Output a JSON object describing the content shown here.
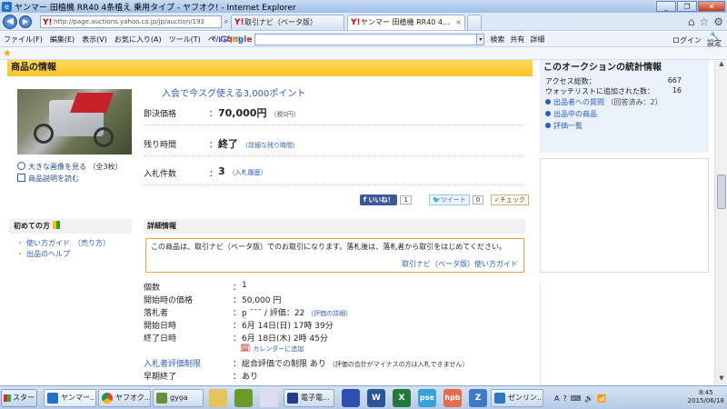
{
  "window": {
    "title": "ヤンマー 田植機 RR40 4条植え 乗用タイプ - ヤフオク! - Internet Explorer"
  },
  "address": {
    "url": "http://page.auctions.yahoo.co.jp/jp/auction/193",
    "tabs": [
      {
        "label": "取引ナビ（ベータ版）"
      },
      {
        "label": "ヤンマー 田植機 RR40 4..."
      }
    ]
  },
  "menu": {
    "items": [
      "ファイル(F)",
      "編集(E)",
      "表示(V)",
      "お気に入り(A)",
      "ツール(T)",
      "ヘルプ(H)"
    ],
    "google_buttons": [
      "検索",
      "共有",
      "詳細"
    ],
    "login": "ログイン",
    "settings": "設定"
  },
  "product": {
    "section_title": "商品の情報",
    "promo": "入会で今スグ使える3,000ポイント",
    "image_links": [
      {
        "label": "大きな画像を見る",
        "extra": "（全3枚）"
      },
      {
        "label": "商品説明を読む",
        "extra": ""
      }
    ],
    "fields": [
      {
        "label": "即決価格",
        "value": "70,000円",
        "sub": "（税0円）",
        "sub_is_link": false
      },
      {
        "label": "残り時間",
        "value": "終了",
        "sub": "（詳細な残り時間）",
        "sub_is_link": true
      },
      {
        "label": "入札件数",
        "value": "3",
        "sub": "（入札履歴）",
        "sub_is_link": true
      }
    ],
    "social": {
      "like": "いいね！",
      "like_count": "1",
      "tweet": "ツイート",
      "tweet_count": "0",
      "check": "チェック"
    }
  },
  "first_time": {
    "title": "初めての方",
    "links": [
      "使い方ガイド　（売り方）",
      "出品のヘルプ"
    ]
  },
  "details": {
    "title": "詳細情報",
    "notice": "この商品は、取引ナビ（ベータ版）でのお取引になります。落札後は、落札者から取引をはじめてください。",
    "notice_link": "取引ナビ（ベータ版）使い方ガイド",
    "rows": [
      {
        "label": "個数",
        "value": "1",
        "note": ""
      },
      {
        "label": "開始時の価格",
        "value": "50,000 円",
        "note": ""
      },
      {
        "label": "落札者",
        "value": "p̣̣ ˉˉˉ / 評価：22",
        "note": "（評価の詳細）"
      },
      {
        "label": "開始日時",
        "value": "6月 14日(日) 17時 39分",
        "note": ""
      },
      {
        "label": "終了日時",
        "value": "6月 18日(木) 2時 45分",
        "note": ""
      },
      {
        "label": "",
        "value": "カレンダーに追加",
        "note": ""
      },
      {
        "label": "入札者評価制限",
        "value": "総合評価での制限 あり",
        "note": "（評価の合計がマイナスの方は入札できません）"
      },
      {
        "label": "早期終了",
        "value": "あり",
        "note": ""
      }
    ]
  },
  "stats": {
    "title": "このオークションの統計情報",
    "rows": [
      {
        "label": "アクセス総数",
        "value": "667"
      },
      {
        "label": "ウォッチリストに追加された数",
        "value": "16"
      }
    ],
    "links": [
      {
        "label": "出品者への質問",
        "extra": "（回答済み：2）"
      },
      {
        "label": "出品中の商品",
        "extra": ""
      },
      {
        "label": "評価一覧",
        "extra": ""
      }
    ]
  },
  "taskbar": {
    "start": "スタート",
    "tasks": [
      "ヤンマー...",
      "ヤフオク...",
      "gyọ̣a",
      "電子電..."
    ],
    "extra": [
      "ゼンリン..."
    ],
    "time": "8:45",
    "date": "2015/06/18"
  },
  "colors": {
    "section_yellow": "#f8c42b",
    "link_blue": "#2b5fb5",
    "notice_border": "#e8a53a",
    "stats_bg": "#eaf1fb"
  }
}
